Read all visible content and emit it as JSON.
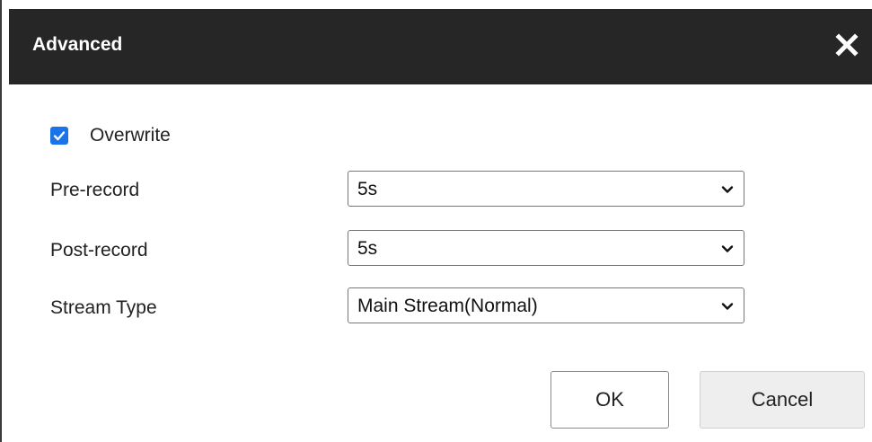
{
  "dialog": {
    "title": "Advanced",
    "close_icon": "close-icon"
  },
  "overwrite": {
    "label": "Overwrite",
    "checked": true
  },
  "fields": {
    "pre_record": {
      "label": "Pre-record",
      "value": "5s"
    },
    "post_record": {
      "label": "Post-record",
      "value": "5s"
    },
    "stream_type": {
      "label": "Stream Type",
      "value": "Main Stream(Normal)"
    }
  },
  "buttons": {
    "ok": "OK",
    "cancel": "Cancel"
  },
  "colors": {
    "titlebar": "#262626",
    "checkbox_accent": "#1a73e8",
    "cancel_bg": "#eeeeee"
  }
}
